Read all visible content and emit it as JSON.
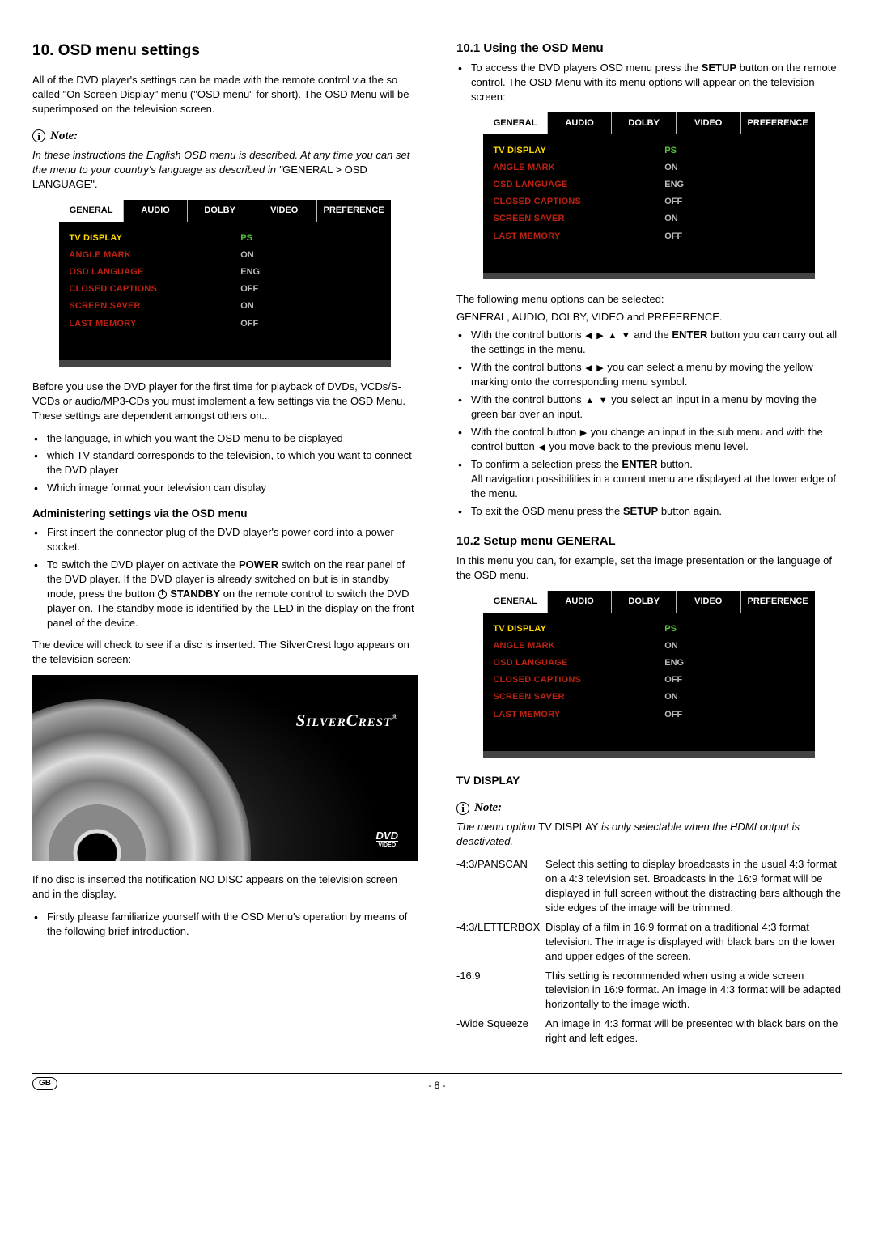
{
  "section_title": "10. OSD menu settings",
  "intro_para": "All of the DVD player's settings can be made with the remote control via the so called \"On Screen Display\" menu (\"OSD menu\" for short). The OSD Menu will be superimposed on the television screen.",
  "note_label": "Note:",
  "note1_text_a": "In these instructions the English OSD menu is described. At any time you can set the menu to your country's language as described in \"",
  "note1_text_b": "GENERAL > OSD LANGUAGE\".",
  "osd": {
    "tabs": [
      "GENERAL",
      "AUDIO",
      "DOLBY",
      "VIDEO",
      "PREFERENCE"
    ],
    "rows": [
      {
        "label": "TV DISPLAY",
        "value": "PS",
        "sel": true
      },
      {
        "label": "ANGLE MARK",
        "value": "ON"
      },
      {
        "label": "OSD LANGUAGE",
        "value": "ENG"
      },
      {
        "label": "CLOSED CAPTIONS",
        "value": "OFF"
      },
      {
        "label": "SCREEN SAVER",
        "value": "ON"
      },
      {
        "label": "LAST MEMORY",
        "value": "OFF"
      }
    ]
  },
  "before_use_para": "Before you use the DVD player for the first time for playback of DVDs, VCDs/S-VCDs or audio/MP3-CDs you must implement a few settings via the OSD Menu. These settings are dependent amongst others on...",
  "before_use_bullets": [
    "the language, in which you want the OSD menu to be displayed",
    "which TV standard corresponds to the television, to which you want to connect the DVD player",
    "Which image format your television can display"
  ],
  "admin_heading": "Administering settings via the OSD menu",
  "admin_b1": "First insert the connector plug of the DVD player's power cord into a power socket.",
  "admin_b2_a": "To switch the DVD player on activate the ",
  "admin_b2_power": "POWER",
  "admin_b2_b": " switch on the rear panel of the DVD player. If the DVD player is already switched on but is in standby mode, press the button ",
  "admin_b2_standby": "STANDBY",
  "admin_b2_c": " on the remote control to switch the DVD player on. The standby mode is identified by the LED in the display on the front panel of the device.",
  "device_check": "The device will check to see if a disc is inserted. The SilverCrest logo appears on the television screen:",
  "silvercrest": "SilverCrest",
  "dvd_badge_top": "DVD",
  "dvd_badge_bot": "VIDEO",
  "nodisc_a": "If no disc is inserted the notification ",
  "nodisc_b": "NO DISC",
  "nodisc_c": " appears on the television screen and in the display.",
  "familiarize": "Firstly please familiarize yourself with the OSD Menu's operation by means of the following brief introduction.",
  "s101_title": "10.1 Using the OSD Menu",
  "s101_b1_a": "To access the DVD players OSD menu press the ",
  "s101_b1_setup": "SETUP",
  "s101_b1_b": " button on the remote control. The OSD Menu with its menu options will appear on the television screen:",
  "following_a": "The following menu options can be selected:",
  "following_b": "GENERAL, AUDIO, DOLBY, VIDEO and PREFERENCE.",
  "r2_b1_a": "With the control buttons ",
  "r2_b1_b": " and the ",
  "r2_b1_enter": "ENTER",
  "r2_b1_c": " button you can carry out all the settings in the menu.",
  "r2_b2_a": "With the control buttons ",
  "r2_b2_b": " you can select a menu by moving the yellow marking onto the corresponding menu symbol.",
  "r2_b3_a": "With the control buttons ",
  "r2_b3_b": " you select an input in a menu by moving the green bar over an input.",
  "r2_b4_a": "With the control button ",
  "r2_b4_b": " you change an input in the sub menu and with the control button ",
  "r2_b4_c": " you move back to the previous menu level.",
  "r2_b5_a": "To confirm a selection press the ",
  "r2_b5_b": " button.",
  "r2_b5_c": "All navigation possibilities in a current menu are displayed at the lower edge of the menu.",
  "r2_b6_a": "To exit the OSD menu press the ",
  "r2_b6_b": " button again.",
  "s102_title": "10.2 Setup menu GENERAL",
  "s102_intro": "In this menu you can, for example, set the image presentation or the language of the OSD menu.",
  "tvdisplay_heading": "TV DISPLAY",
  "note2_a": "The menu option ",
  "note2_b": "TV DISPLAY",
  "note2_c": " is only selectable when the HDMI output is deactivated.",
  "defs": [
    {
      "term": "-4:3/PANSCAN",
      "desc": "Select this setting to display broadcasts in the usual 4:3 format on a 4:3 television set. Broadcasts in the 16:9 format will be displayed in full screen without the distracting bars although the side edges of the image will be trimmed."
    },
    {
      "term": "-4:3/LETTERBOX",
      "desc": "Display of a film in 16:9 format on a traditional 4:3 format television. The image is displayed with black bars on the lower and upper edges of the screen."
    },
    {
      "term": "-16:9",
      "desc": "This setting is recommended when using a wide screen television in 16:9 format. An image in 4:3 format will be adapted horizontally to the image width."
    },
    {
      "term": "-Wide Squeeze",
      "desc": "An image in 4:3 format will be presented with black bars on the right and left edges."
    }
  ],
  "footer_page": "- 8 -",
  "footer_gb": "GB"
}
